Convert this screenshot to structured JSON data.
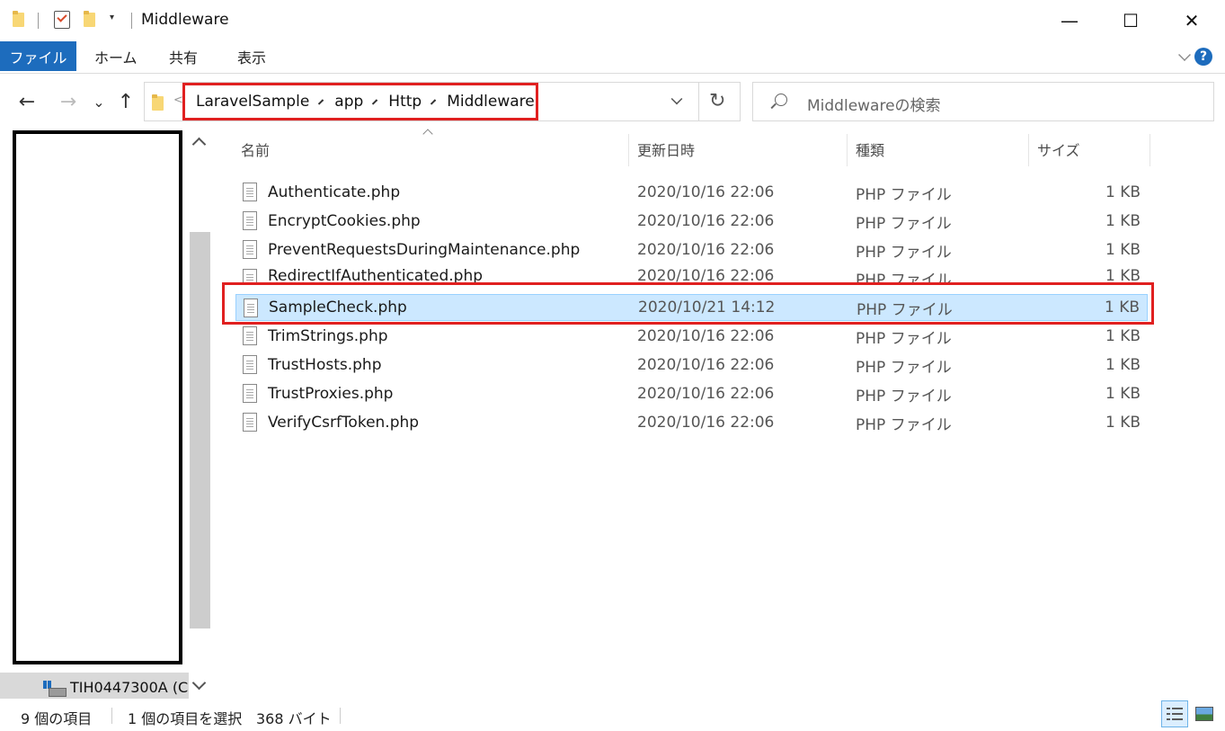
{
  "window": {
    "title": "Middleware",
    "minimize_glyph": "—",
    "maximize_glyph": "☐",
    "close_glyph": "✕"
  },
  "quick_access": {
    "icons": [
      "folder-icon",
      "properties-icon",
      "new-folder-icon",
      "customize-dropdown-icon"
    ],
    "dropdown_glyph": "▾"
  },
  "ribbon": {
    "tabs": [
      {
        "label": "ファイル",
        "active": true
      },
      {
        "label": "ホーム"
      },
      {
        "label": "共有"
      },
      {
        "label": "表示"
      }
    ],
    "help_glyph": "?"
  },
  "navigation": {
    "back_glyph": "←",
    "forward_glyph": "→",
    "recent_glyph": "⌄",
    "up_glyph": "↑"
  },
  "address": {
    "overflow_glyph": "<",
    "crumbs": [
      "LaravelSample",
      "app",
      "Http",
      "Middleware"
    ],
    "refresh_glyph": "↻"
  },
  "search": {
    "placeholder": "Middlewareの検索"
  },
  "nav_pane": {
    "drive_label": "TIH0447300A (C"
  },
  "columns": {
    "name": "名前",
    "date": "更新日時",
    "type": "種類",
    "size": "サイズ"
  },
  "files": [
    {
      "name": "Authenticate.php",
      "date": "2020/10/16 22:06",
      "type": "PHP ファイル",
      "size": "1 KB"
    },
    {
      "name": "EncryptCookies.php",
      "date": "2020/10/16 22:06",
      "type": "PHP ファイル",
      "size": "1 KB"
    },
    {
      "name": "PreventRequestsDuringMaintenance.php",
      "date": "2020/10/16 22:06",
      "type": "PHP ファイル",
      "size": "1 KB"
    },
    {
      "name": "RedirectIfAuthenticated.php",
      "date": "2020/10/16 22:06",
      "type": "PHP ファイル",
      "size": "1 KB"
    },
    {
      "name": "SampleCheck.php",
      "date": "2020/10/21 14:12",
      "type": "PHP ファイル",
      "size": "1 KB",
      "selected": true
    },
    {
      "name": "TrimStrings.php",
      "date": "2020/10/16 22:06",
      "type": "PHP ファイル",
      "size": "1 KB"
    },
    {
      "name": "TrustHosts.php",
      "date": "2020/10/16 22:06",
      "type": "PHP ファイル",
      "size": "1 KB"
    },
    {
      "name": "TrustProxies.php",
      "date": "2020/10/16 22:06",
      "type": "PHP ファイル",
      "size": "1 KB"
    },
    {
      "name": "VerifyCsrfToken.php",
      "date": "2020/10/16 22:06",
      "type": "PHP ファイル",
      "size": "1 KB"
    }
  ],
  "status": {
    "item_count": "9 個の項目",
    "selected_count": "1 個の項目を選択",
    "selected_size": "368 バイト"
  },
  "colors": {
    "accent": "#1d6cbd",
    "selection_bg": "#cce8ff",
    "annotation_red": "#e02020"
  }
}
